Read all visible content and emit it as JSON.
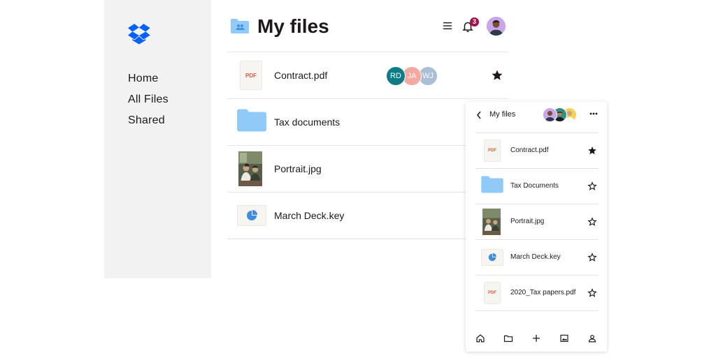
{
  "nav": {
    "items": [
      "Home",
      "All Files",
      "Shared"
    ]
  },
  "header": {
    "title": "My files",
    "notification_count": "3"
  },
  "files": [
    {
      "name": "Contract.pdf",
      "type": "pdf",
      "thumb_text": "PDF",
      "starred": true,
      "collaborators": [
        {
          "initials": "RD",
          "color": "#0e7c86"
        },
        {
          "initials": "JA",
          "color": "#f4a9a0"
        },
        {
          "initials": "WJ",
          "color": "#a9bfd6"
        }
      ]
    },
    {
      "name": "Tax documents",
      "type": "folder",
      "starred": false,
      "collaborators": []
    },
    {
      "name": "Portrait.jpg",
      "type": "photo",
      "starred": false,
      "collaborators": []
    },
    {
      "name": "March Deck.key",
      "type": "keynote",
      "starred": false,
      "collaborators": []
    }
  ],
  "mobile": {
    "title": "My files",
    "files": [
      {
        "name": "Contract.pdf",
        "type": "pdf",
        "thumb_text": "PDF",
        "starred": true
      },
      {
        "name": "Tax Documents",
        "type": "folder",
        "starred": false
      },
      {
        "name": "Portrait.jpg",
        "type": "photo",
        "starred": false
      },
      {
        "name": "March Deck.key",
        "type": "keynote",
        "starred": false
      },
      {
        "name": "2020_Tax papers.pdf",
        "type": "pdf",
        "thumb_text": "PDF",
        "starred": false
      }
    ],
    "tabs": [
      "home-icon",
      "folder-icon",
      "plus-icon",
      "photos-icon",
      "account-icon"
    ]
  },
  "colors": {
    "brand": "#0061fe",
    "folder": "#90caf9",
    "badge": "#a0144a",
    "sidebar_bg": "#f2f2f2"
  }
}
